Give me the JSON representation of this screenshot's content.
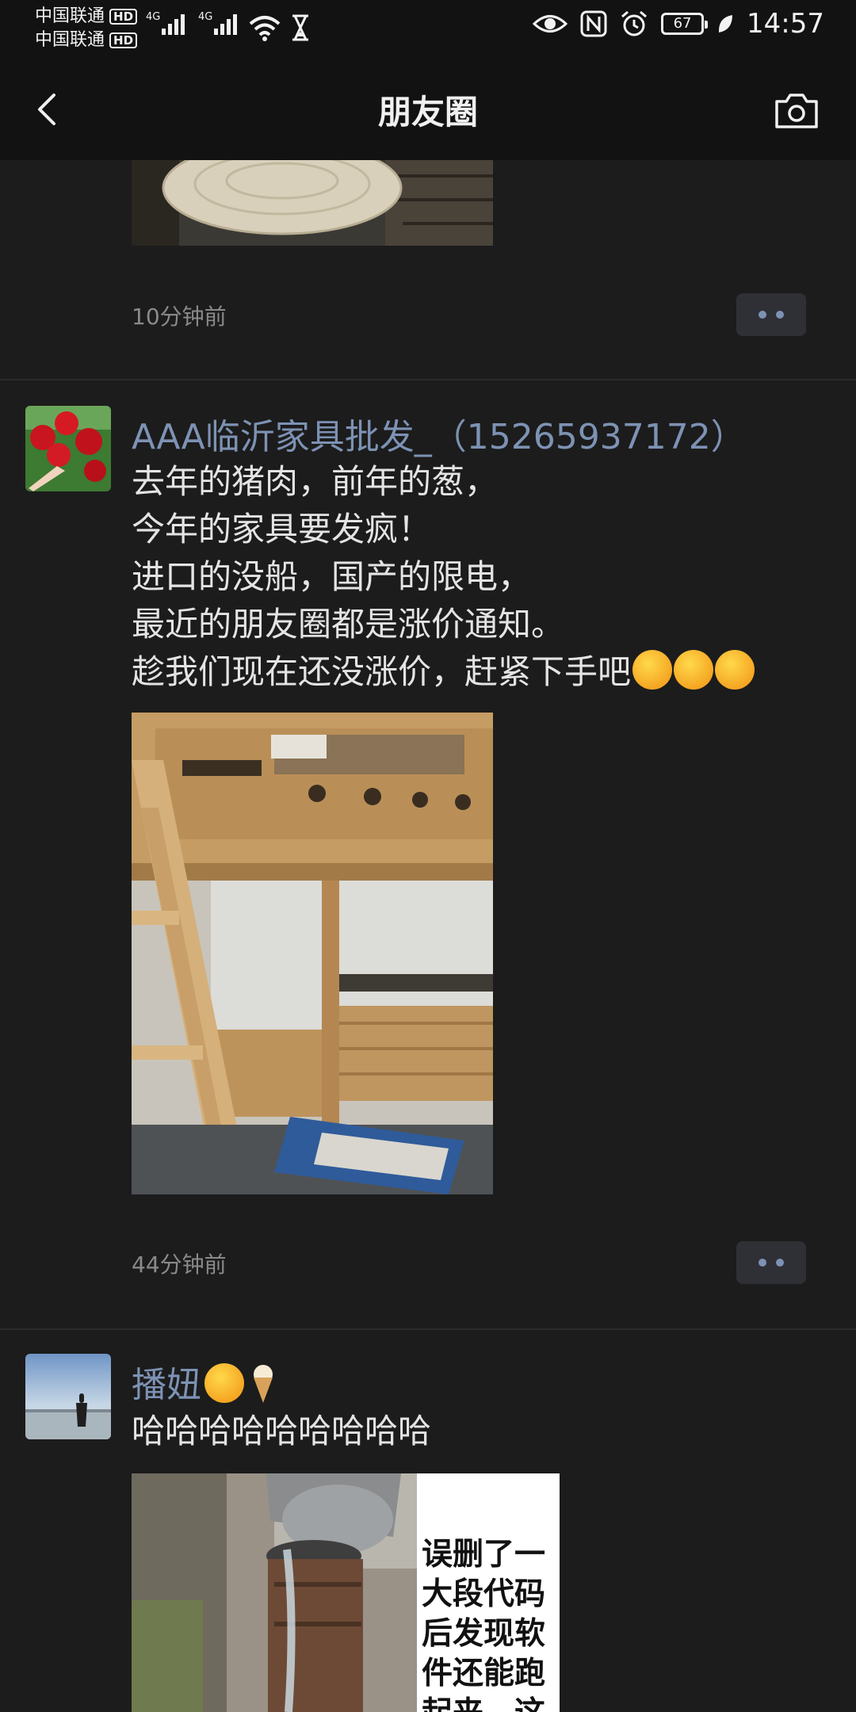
{
  "status_bar": {
    "carrier_1": "中国联通",
    "carrier_2": "中国联通",
    "hd_badge": "HD",
    "network_1": "4G",
    "network_2": "4G",
    "battery": "67",
    "time": "14:57"
  },
  "nav": {
    "title": "朋友圈",
    "back_icon": "chevron-left-icon",
    "camera_icon": "camera-icon"
  },
  "posts": [
    {
      "timestamp": "10分钟前"
    },
    {
      "name": "AAA临沂家具批发_（15265937172）",
      "text": "去年的猪肉，前年的葱，\n今年的家具要发疯！\n进口的没船，国产的限电，\n最近的朋友圈都是涨价通知。\n趁我们现在还没涨价，赶紧下手吧",
      "timestamp": "44分钟前"
    },
    {
      "name": "播妞",
      "text": "哈哈哈哈哈哈哈哈哈",
      "image_caption": "误删了一大段代码后发现软件还能跑起来，这"
    }
  ],
  "colors": {
    "background": "#1c1c1c",
    "bar": "#121212",
    "name_link": "#7d92b4",
    "timestamp": "#8a8a8a"
  }
}
